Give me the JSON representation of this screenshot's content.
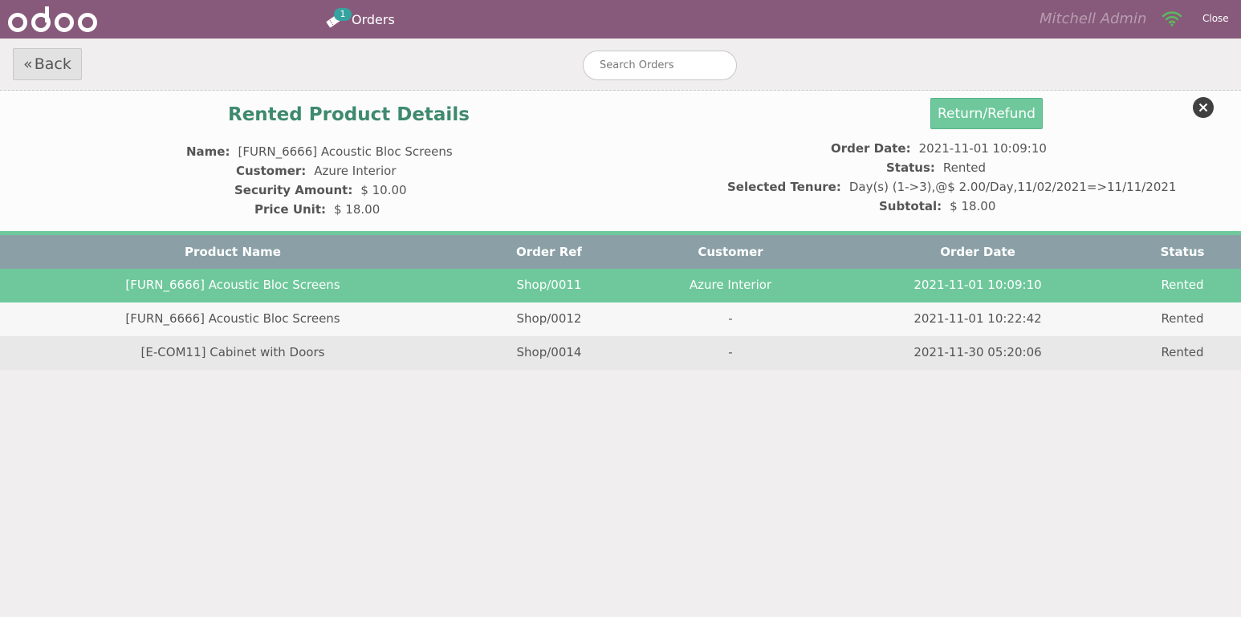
{
  "header": {
    "logo_text": "odoo",
    "orders_label": "Orders",
    "orders_badge": "1",
    "user_name": "Mitchell Admin",
    "close_label": "Close"
  },
  "controls": {
    "back_label": "Back",
    "search_placeholder": "Search Orders"
  },
  "details": {
    "title": "Rented Product Details",
    "return_label": "Return/Refund",
    "left": [
      {
        "label": "Name:",
        "value": "[FURN_6666] Acoustic Bloc Screens"
      },
      {
        "label": "Customer:",
        "value": "Azure Interior"
      },
      {
        "label": "Security Amount:",
        "value": "$ 10.00"
      },
      {
        "label": "Price Unit:",
        "value": "$ 18.00"
      }
    ],
    "right": [
      {
        "label": "Order Date:",
        "value": "2021-11-01 10:09:10"
      },
      {
        "label": "Status:",
        "value": "Rented"
      },
      {
        "label": "Selected Tenure:",
        "value": "Day(s) (1->3),@$ 2.00/Day,11/02/2021=>11/11/2021"
      },
      {
        "label": "Subtotal:",
        "value": "$ 18.00"
      }
    ]
  },
  "table": {
    "columns": [
      "Product Name",
      "Order Ref",
      "Customer",
      "Order Date",
      "Status"
    ],
    "rows": [
      [
        "[FURN_6666] Acoustic Bloc Screens",
        "Shop/0011",
        "Azure Interior",
        "2021-11-01 10:09:10",
        "Rented"
      ],
      [
        "[FURN_6666] Acoustic Bloc Screens",
        "Shop/0012",
        "-",
        "2021-11-01 10:22:42",
        "Rented"
      ],
      [
        "[E-COM11] Cabinet with Doors",
        "Shop/0014",
        "-",
        "2021-11-30 05:20:06",
        "Rented"
      ]
    ]
  },
  "colors": {
    "header_bg": "#875a7b",
    "accent_green": "#6ec89b",
    "title_green": "#3f8a6f",
    "table_header_bg": "#8aa0a6",
    "wifi_green": "#5cb85c"
  }
}
